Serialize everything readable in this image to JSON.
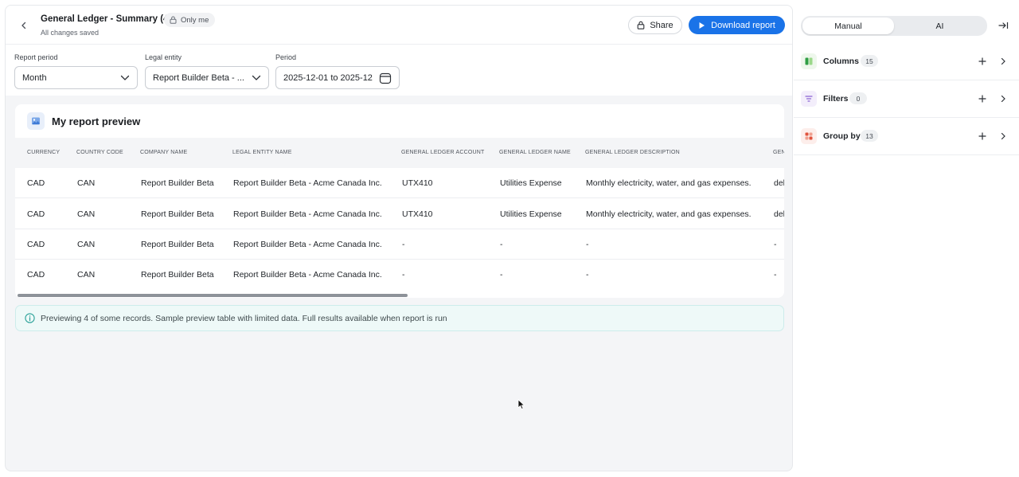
{
  "header": {
    "title": "General Ledger - Summary (4)",
    "privacy": "Only me",
    "status": "All changes saved",
    "share_label": "Share",
    "download_label": "Download report"
  },
  "filters": {
    "report_period": {
      "label": "Report period",
      "value": "Month"
    },
    "legal_entity": {
      "label": "Legal entity",
      "value": "Report Builder Beta - ..."
    },
    "period": {
      "label": "Period",
      "value": "2025-12-01 to 2025-12-"
    }
  },
  "preview": {
    "title": "My report preview",
    "columns": [
      "CURRENCY",
      "COUNTRY CODE",
      "COMPANY NAME",
      "LEGAL ENTITY NAME",
      "GENERAL LEDGER ACCOUNT",
      "GENERAL LEDGER NAME",
      "GENERAL LEDGER DESCRIPTION",
      "GEN"
    ],
    "rows": [
      [
        "CAD",
        "CAN",
        "Report Builder Beta",
        "Report Builder Beta - Acme Canada Inc.",
        "UTX410",
        "Utilities Expense",
        "Monthly electricity, water, and gas expenses.",
        "del"
      ],
      [
        "CAD",
        "CAN",
        "Report Builder Beta",
        "Report Builder Beta - Acme Canada Inc.",
        "UTX410",
        "Utilities Expense",
        "Monthly electricity, water, and gas expenses.",
        "del"
      ],
      [
        "CAD",
        "CAN",
        "Report Builder Beta",
        "Report Builder Beta - Acme Canada Inc.",
        "-",
        "-",
        "-",
        "-"
      ],
      [
        "CAD",
        "CAN",
        "Report Builder Beta",
        "Report Builder Beta - Acme Canada Inc.",
        "-",
        "-",
        "-",
        "-"
      ]
    ],
    "info": "Previewing 4 of some records. Sample preview table with limited data. Full results available when report is run"
  },
  "side": {
    "modes": [
      "Manual",
      "AI"
    ],
    "active_mode": "Manual",
    "sections": [
      {
        "label": "Columns",
        "count": "15",
        "icon": "columns-icon",
        "color": "#5cb85c"
      },
      {
        "label": "Filters",
        "count": "0",
        "icon": "filter-icon",
        "color": "#8a63d2"
      },
      {
        "label": "Group by",
        "count": "13",
        "icon": "group-by-icon",
        "color": "#e0533d"
      }
    ]
  },
  "colors": {
    "accent": "#1a73e8",
    "info_bg": "#eef9f8",
    "info_icon": "#2aa198"
  }
}
